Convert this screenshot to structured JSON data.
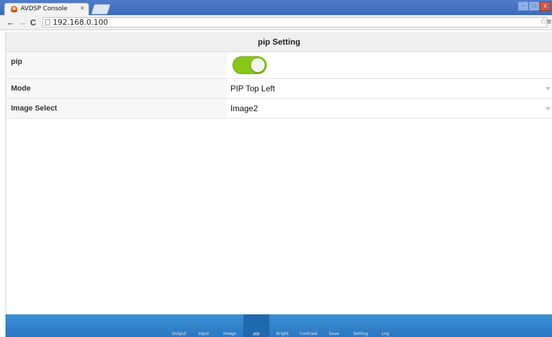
{
  "browser": {
    "tab_title": "AVDSP Console",
    "tab_close": "×",
    "url": "192.168.0.100",
    "back_glyph": "←",
    "forward_glyph": "→",
    "reload_glyph": "C",
    "min_glyph": "–",
    "max_glyph": "□",
    "close_glyph": "x",
    "star_glyph": "☆",
    "menu_glyph": "≡"
  },
  "page": {
    "title": "pip Setting",
    "rows": [
      {
        "label": "pip",
        "type": "toggle",
        "on": true
      },
      {
        "label": "Mode",
        "type": "select",
        "value": "PIP Top Left"
      },
      {
        "label": "Image Select",
        "type": "select",
        "value": "Image2"
      }
    ]
  },
  "bottom_nav": {
    "items": [
      "Output",
      "Input",
      "Image",
      "pip",
      "Bright",
      "Contrast",
      "Save",
      "Setting",
      "Log"
    ],
    "active": "pip"
  },
  "colors": {
    "toggle_on": "#86c817",
    "nav_bar": "#2a78c0",
    "nav_active": "#1f69ad",
    "title_bar": "#3c6bbf"
  },
  "icons": {
    "favicon": "avdsp-logo-icon",
    "page": "page-icon",
    "star": "star-icon",
    "menu": "menu-icon"
  }
}
